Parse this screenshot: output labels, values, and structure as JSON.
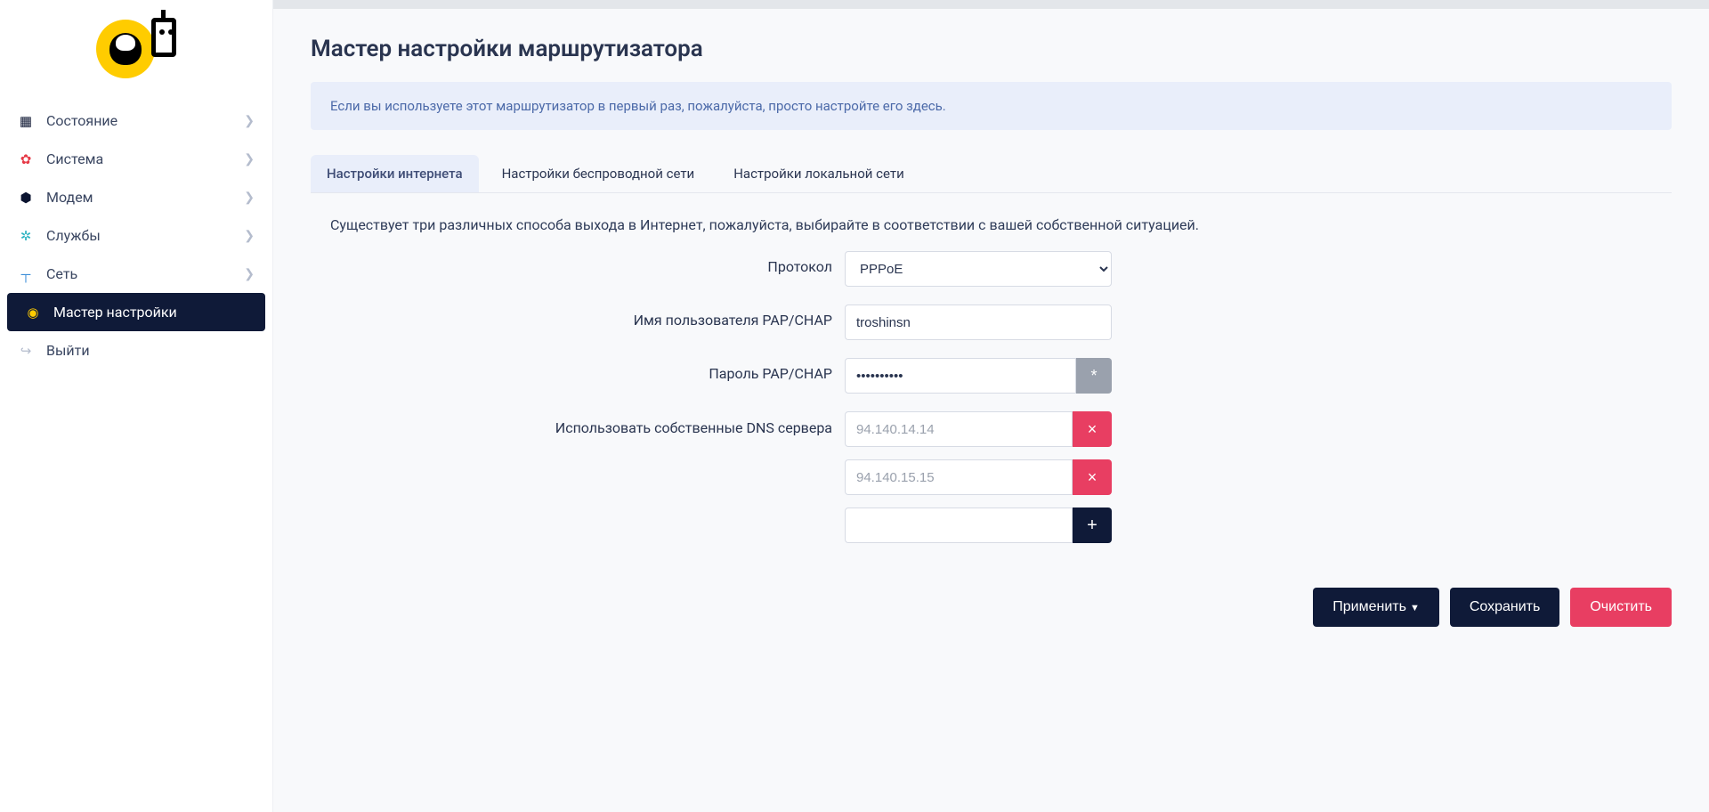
{
  "sidebar": {
    "items": [
      {
        "label": "Состояние",
        "icon": "dashboard-icon",
        "hasSub": true,
        "active": false
      },
      {
        "label": "Система",
        "icon": "gear-icon",
        "hasSub": true,
        "active": false
      },
      {
        "label": "Модем",
        "icon": "cube-icon",
        "hasSub": true,
        "active": false
      },
      {
        "label": "Службы",
        "icon": "gears-icon",
        "hasSub": true,
        "active": false
      },
      {
        "label": "Сеть",
        "icon": "network-icon",
        "hasSub": true,
        "active": false
      },
      {
        "label": "Мастер настройки",
        "icon": "wizard-icon",
        "hasSub": false,
        "active": true
      },
      {
        "label": "Выйти",
        "icon": "logout-icon",
        "hasSub": false,
        "active": false
      }
    ]
  },
  "page": {
    "title": "Мастер настройки маршрутизатора",
    "info": "Если вы используете этот маршрутизатор в первый раз, пожалуйста, просто настройте его здесь."
  },
  "tabs": [
    {
      "label": "Настройки интернета",
      "active": true
    },
    {
      "label": "Настройки беспроводной сети",
      "active": false
    },
    {
      "label": "Настройки локальной сети",
      "active": false
    }
  ],
  "form": {
    "desc": "Существует три различных способа выхода в Интернет, пожалуйста, выбирайте в соответствии с вашей собственной ситуацией.",
    "protocol": {
      "label": "Протокол",
      "value": "PPPoE"
    },
    "username": {
      "label": "Имя пользователя PAP/CHAP",
      "value": "troshinsn"
    },
    "password": {
      "label": "Пароль PAP/CHAP",
      "value": "••••••••••",
      "toggle": "*"
    },
    "dns": {
      "label": "Использовать собственные DNS сервера",
      "entries": [
        "94.140.14.14",
        "94.140.15.15"
      ],
      "remove": "×",
      "add": "+"
    }
  },
  "actions": {
    "apply": "Применить",
    "save": "Сохранить",
    "clear": "Очистить"
  }
}
